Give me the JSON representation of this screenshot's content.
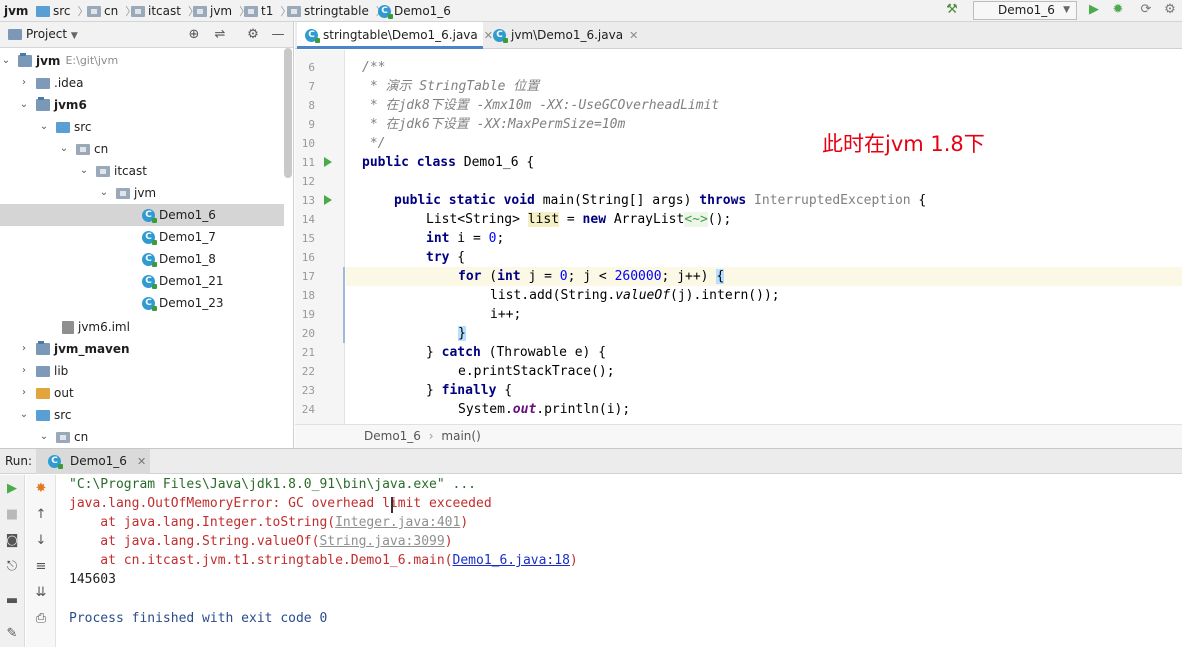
{
  "breadcrumb": [
    "jvm",
    "src",
    "cn",
    "itcast",
    "jvm",
    "t1",
    "stringtable",
    "Demo1_6"
  ],
  "toolbar": {
    "run_config": "Demo1_6"
  },
  "project": {
    "title": "Project",
    "tree": [
      {
        "label": "jvm",
        "path": "E:\\git\\jvm"
      },
      {
        "label": ".idea"
      },
      {
        "label": "jvm6"
      },
      {
        "label": "src"
      },
      {
        "label": "cn"
      },
      {
        "label": "itcast"
      },
      {
        "label": "jvm"
      },
      {
        "label": "Demo1_6"
      },
      {
        "label": "Demo1_7"
      },
      {
        "label": "Demo1_8"
      },
      {
        "label": "Demo1_21"
      },
      {
        "label": "Demo1_23"
      },
      {
        "label": "jvm6.iml"
      },
      {
        "label": "jvm_maven"
      },
      {
        "label": "lib"
      },
      {
        "label": "out"
      },
      {
        "label": "src"
      },
      {
        "label": "cn"
      }
    ]
  },
  "editor": {
    "tabs": [
      "stringtable\\Demo1_6.java",
      "jvm\\Demo1_6.java"
    ],
    "line_numbers": [
      "6",
      "7",
      "8",
      "9",
      "10",
      "11",
      "12",
      "13",
      "14",
      "15",
      "16",
      "17",
      "18",
      "19",
      "20",
      "21",
      "22",
      "23",
      "24"
    ],
    "code": {
      "l6": "/**",
      "l7": " * 演示 StringTable 位置",
      "l8": " * 在jdk8下设置 -Xmx10m -XX:-UseGCOverheadLimit",
      "l9": " * 在jdk6下设置 -XX:MaxPermSize=10m",
      "l10": " */",
      "l11_kw": "public class",
      "l11_rest": " Demo1_6 {",
      "l13_kw": "public static void",
      "l13_mid": " main(String[] args) ",
      "l13_kw2": "throws",
      "l13_exc": " InterruptedException",
      "l13_end": " {",
      "l14_a": "List<String> ",
      "l14_var": "list",
      "l14_b": " = ",
      "l14_kw": "new",
      "l14_c": " ArrayList",
      "l14_diamond": "<~>",
      "l14_d": "();",
      "l15_kw": "int",
      "l15_rest": " i = ",
      "l15_num": "0",
      "l15_end": ";",
      "l16_kw": "try",
      "l16_rest": " {",
      "l17_kw": "for",
      "l17_a": " (",
      "l17_kw2": "int",
      "l17_b": " j = ",
      "l17_n1": "0",
      "l17_c": "; j < ",
      "l17_n2": "260000",
      "l17_d": "; j++) ",
      "l17_brace": "{",
      "l18_a": "list.add(String.",
      "l18_ital": "valueOf",
      "l18_b": "(j).intern());",
      "l19": "i++;",
      "l20_brace": "}",
      "l21_a": "} ",
      "l21_kw": "catch",
      "l21_b": " (Throwable e) {",
      "l22": "e.printStackTrace();",
      "l23_a": "} ",
      "l23_kw": "finally",
      "l23_b": " {",
      "l24_a": "System.",
      "l24_field": "out",
      "l24_b": ".println(i);"
    },
    "annotation": "此时在jvm 1.8下",
    "crumb": [
      "Demo1_6",
      "main()"
    ]
  },
  "run": {
    "label": "Run:",
    "tab": "Demo1_6",
    "console": {
      "cmd": "\"C:\\Program Files\\Java\\jdk1.8.0_91\\bin\\java.exe\" ...",
      "error": "java.lang.OutOfMemoryError: GC overhead limit exceeded",
      "st1_a": "    at java.lang.Integer.toString(",
      "st1_link": "Integer.java:401",
      "st1_b": ")",
      "st2_a": "    at java.lang.String.valueOf(",
      "st2_link": "String.java:3099",
      "st2_b": ")",
      "st3_a": "    at cn.itcast.jvm.t1.stringtable.Demo1_6.main(",
      "st3_link": "Demo1_6.java:18",
      "st3_b": ")",
      "value": "145603",
      "finished": "Process finished with exit code 0"
    }
  },
  "colors": {
    "accent": "#4a86c7",
    "annotation": "#e60012",
    "error": "#c22d2d"
  },
  "icons": [
    "folder-icon",
    "package-icon",
    "class-icon",
    "module-icon",
    "run-icon",
    "debug-icon",
    "build-hammer-icon",
    "target-icon",
    "gear-icon",
    "stop-icon",
    "camera-icon",
    "pin-icon",
    "print-icon"
  ]
}
